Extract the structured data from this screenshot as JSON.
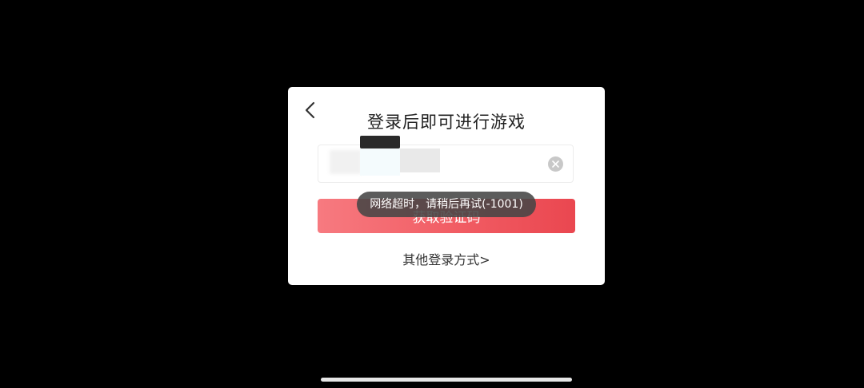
{
  "dialog": {
    "title": "登录后即可进行游戏",
    "phone_input": {
      "value": "",
      "placeholder": ""
    },
    "get_code_label": "获取验证码",
    "other_login_label": "其他登录方式>"
  },
  "toast": {
    "message": "网络超时，请稍后再试(-1001)"
  },
  "icons": {
    "back": "chevron-left-icon",
    "clear": "clear-circle-icon"
  },
  "colors": {
    "button_gradient_start": "#f77a80",
    "button_gradient_end": "#ea4750",
    "toast_background": "#464646",
    "overlay": "#000000"
  }
}
